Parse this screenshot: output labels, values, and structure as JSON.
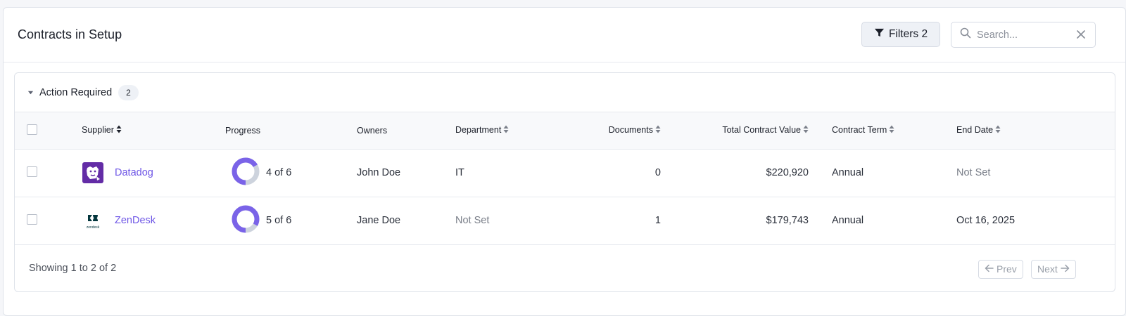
{
  "header": {
    "title": "Contracts in Setup",
    "filters_label": "Filters 2",
    "search_placeholder": "Search..."
  },
  "group": {
    "label": "Action Required",
    "count": "2"
  },
  "columns": {
    "supplier": "Supplier",
    "progress": "Progress",
    "owners": "Owners",
    "department": "Department",
    "documents": "Documents",
    "total_value": "Total Contract Value",
    "term": "Contract Term",
    "end_date": "End Date"
  },
  "rows": [
    {
      "supplier": "Datadog",
      "logo": "datadog-logo",
      "progress_text": "4 of 6",
      "progress_fraction": 0.667,
      "owners": "John Doe",
      "department": "IT",
      "documents": "0",
      "total_value": "$220,920",
      "term": "Annual",
      "end_date": "Not Set"
    },
    {
      "supplier": "ZenDesk",
      "logo": "zendesk-logo",
      "logo_text": "zendesk",
      "progress_text": "5 of 6",
      "progress_fraction": 0.833,
      "owners": "Jane Doe",
      "department": "Not Set",
      "documents": "1",
      "total_value": "$179,743",
      "term": "Annual",
      "end_date": "Oct 16, 2025"
    }
  ],
  "footer": {
    "showing": "Showing 1 to 2 of 2",
    "prev_label": "Prev",
    "next_label": "Next"
  },
  "colors": {
    "accent": "#6e56e6",
    "progress_fill": "#7a63e8",
    "progress_track": "#cdd3dd"
  }
}
